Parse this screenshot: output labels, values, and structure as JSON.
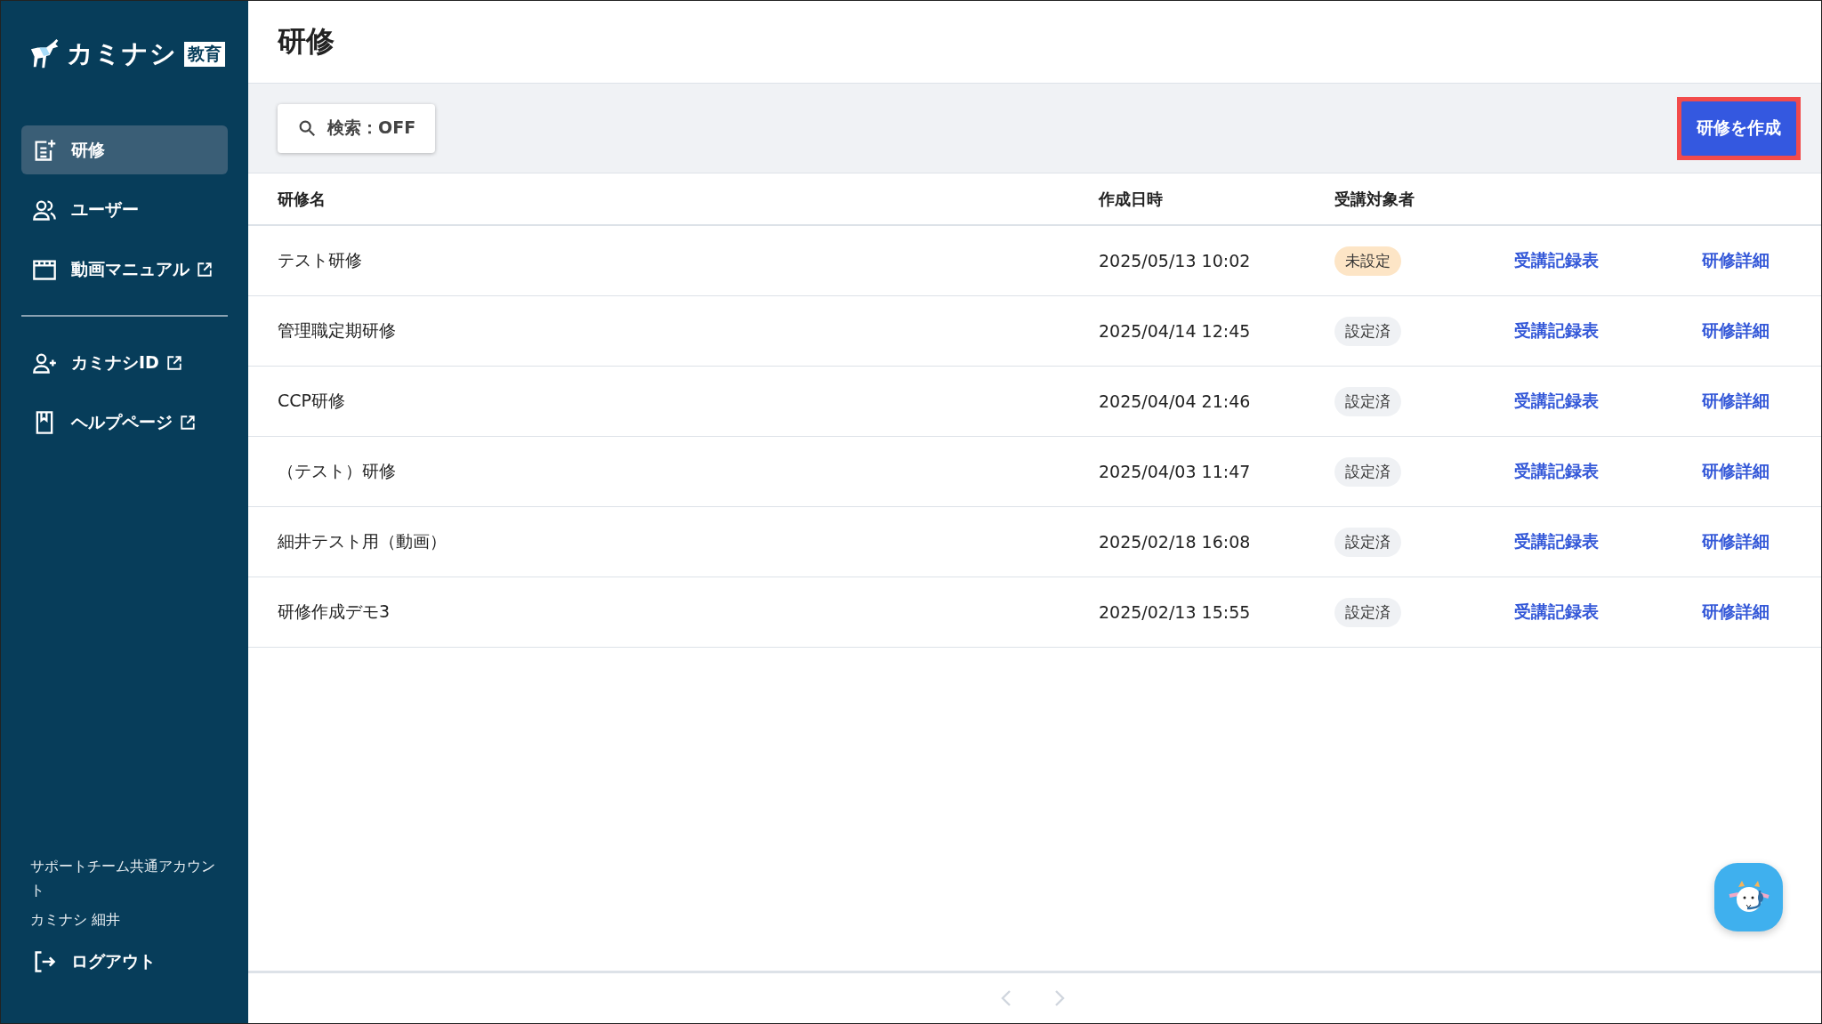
{
  "sidebar": {
    "logo": {
      "name": "カミナシ",
      "badge": "教育"
    },
    "nav": [
      {
        "label": "研修",
        "selected": true,
        "external": false
      },
      {
        "label": "ユーザー",
        "selected": false,
        "external": false
      },
      {
        "label": "動画マニュアル",
        "selected": false,
        "external": true
      }
    ],
    "links": [
      {
        "label": "カミナシID",
        "external": true
      },
      {
        "label": "ヘルプページ",
        "external": true
      }
    ],
    "account": {
      "organization": "サポートチーム共通アカウント",
      "user": "カミナシ 細井"
    },
    "logout": "ログアウト"
  },
  "page": {
    "title": "研修"
  },
  "toolbar": {
    "search": "検索：OFF",
    "create_button": {
      "label": "研修を作成",
      "highlighted": true
    }
  },
  "table": {
    "columns": [
      "研修名",
      "作成日時",
      "受講対象者"
    ],
    "rows": [
      {
        "name": "テスト研修",
        "created": "2025/05/13 10:02",
        "status": {
          "label": "未設定",
          "kind": "unset"
        },
        "record_link": "受講記録表",
        "detail_link": "研修詳細"
      },
      {
        "name": "管理職定期研修",
        "created": "2025/04/14 12:45",
        "status": {
          "label": "設定済",
          "kind": "set"
        },
        "record_link": "受講記録表",
        "detail_link": "研修詳細"
      },
      {
        "name": "CCP研修",
        "created": "2025/04/04 21:46",
        "status": {
          "label": "設定済",
          "kind": "set"
        },
        "record_link": "受講記録表",
        "detail_link": "研修詳細"
      },
      {
        "name": "（テスト）研修",
        "created": "2025/04/03 11:47",
        "status": {
          "label": "設定済",
          "kind": "set"
        },
        "record_link": "受講記録表",
        "detail_link": "研修詳細"
      },
      {
        "name": "細井テスト用（動画）",
        "created": "2025/02/18 16:08",
        "status": {
          "label": "設定済",
          "kind": "set"
        },
        "record_link": "受講記録表",
        "detail_link": "研修詳細"
      },
      {
        "name": "研修作成デモ3",
        "created": "2025/02/13 15:55",
        "status": {
          "label": "設定済",
          "kind": "set"
        },
        "record_link": "受講記録表",
        "detail_link": "研修詳細"
      }
    ]
  },
  "pagination": {
    "previous_disabled": true,
    "next_disabled": true
  }
}
